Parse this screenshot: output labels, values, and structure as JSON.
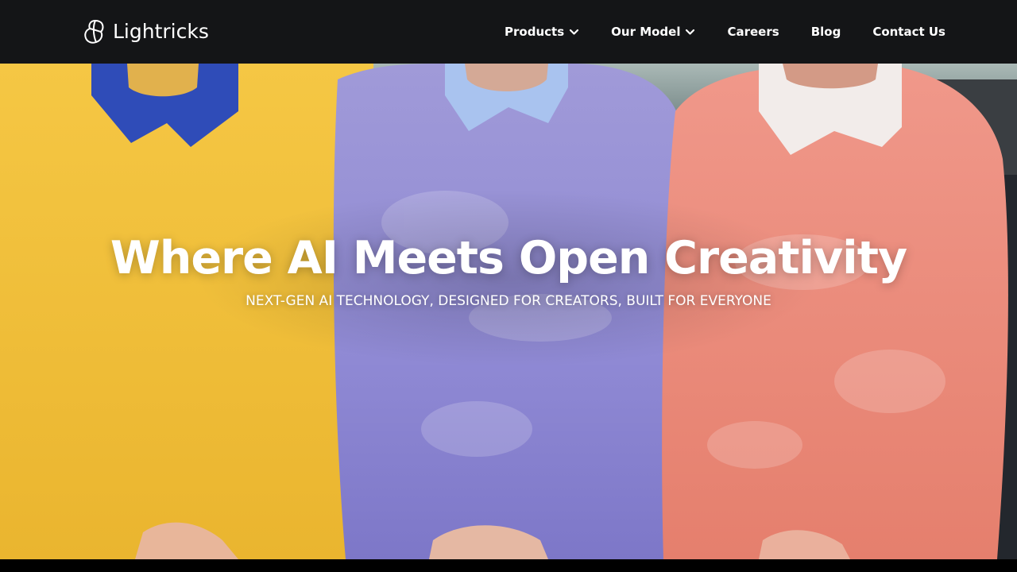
{
  "brand": {
    "name": "Lightricks",
    "logo_icon": "lightricks-logo-mark"
  },
  "nav": {
    "items": [
      {
        "label": "Products",
        "has_dropdown": true,
        "icon": "chevron-down-icon"
      },
      {
        "label": "Our Model",
        "has_dropdown": true,
        "icon": "chevron-down-icon"
      },
      {
        "label": "Careers",
        "has_dropdown": false
      },
      {
        "label": "Blog",
        "has_dropdown": false
      },
      {
        "label": "Contact Us",
        "has_dropdown": false
      }
    ]
  },
  "hero": {
    "title": "Where AI Meets Open Creativity",
    "subtitle": "NEXT-GEN AI TECHNOLOGY, DESIGNED FOR CREATORS, BUILT FOR EVERYONE",
    "image": "three people in yellow, lavender and coral sweaters with collared shirts"
  },
  "colors": {
    "navbar_bg": "#141517",
    "text": "#ffffff",
    "sweater_yellow": "#f2c13c",
    "sweater_lavender": "#8a86d2",
    "sweater_coral": "#ec8a76",
    "collar_blue": "#2f4cb8",
    "collar_lightblue": "#a9c3ef",
    "collar_white": "#f2ecea"
  }
}
